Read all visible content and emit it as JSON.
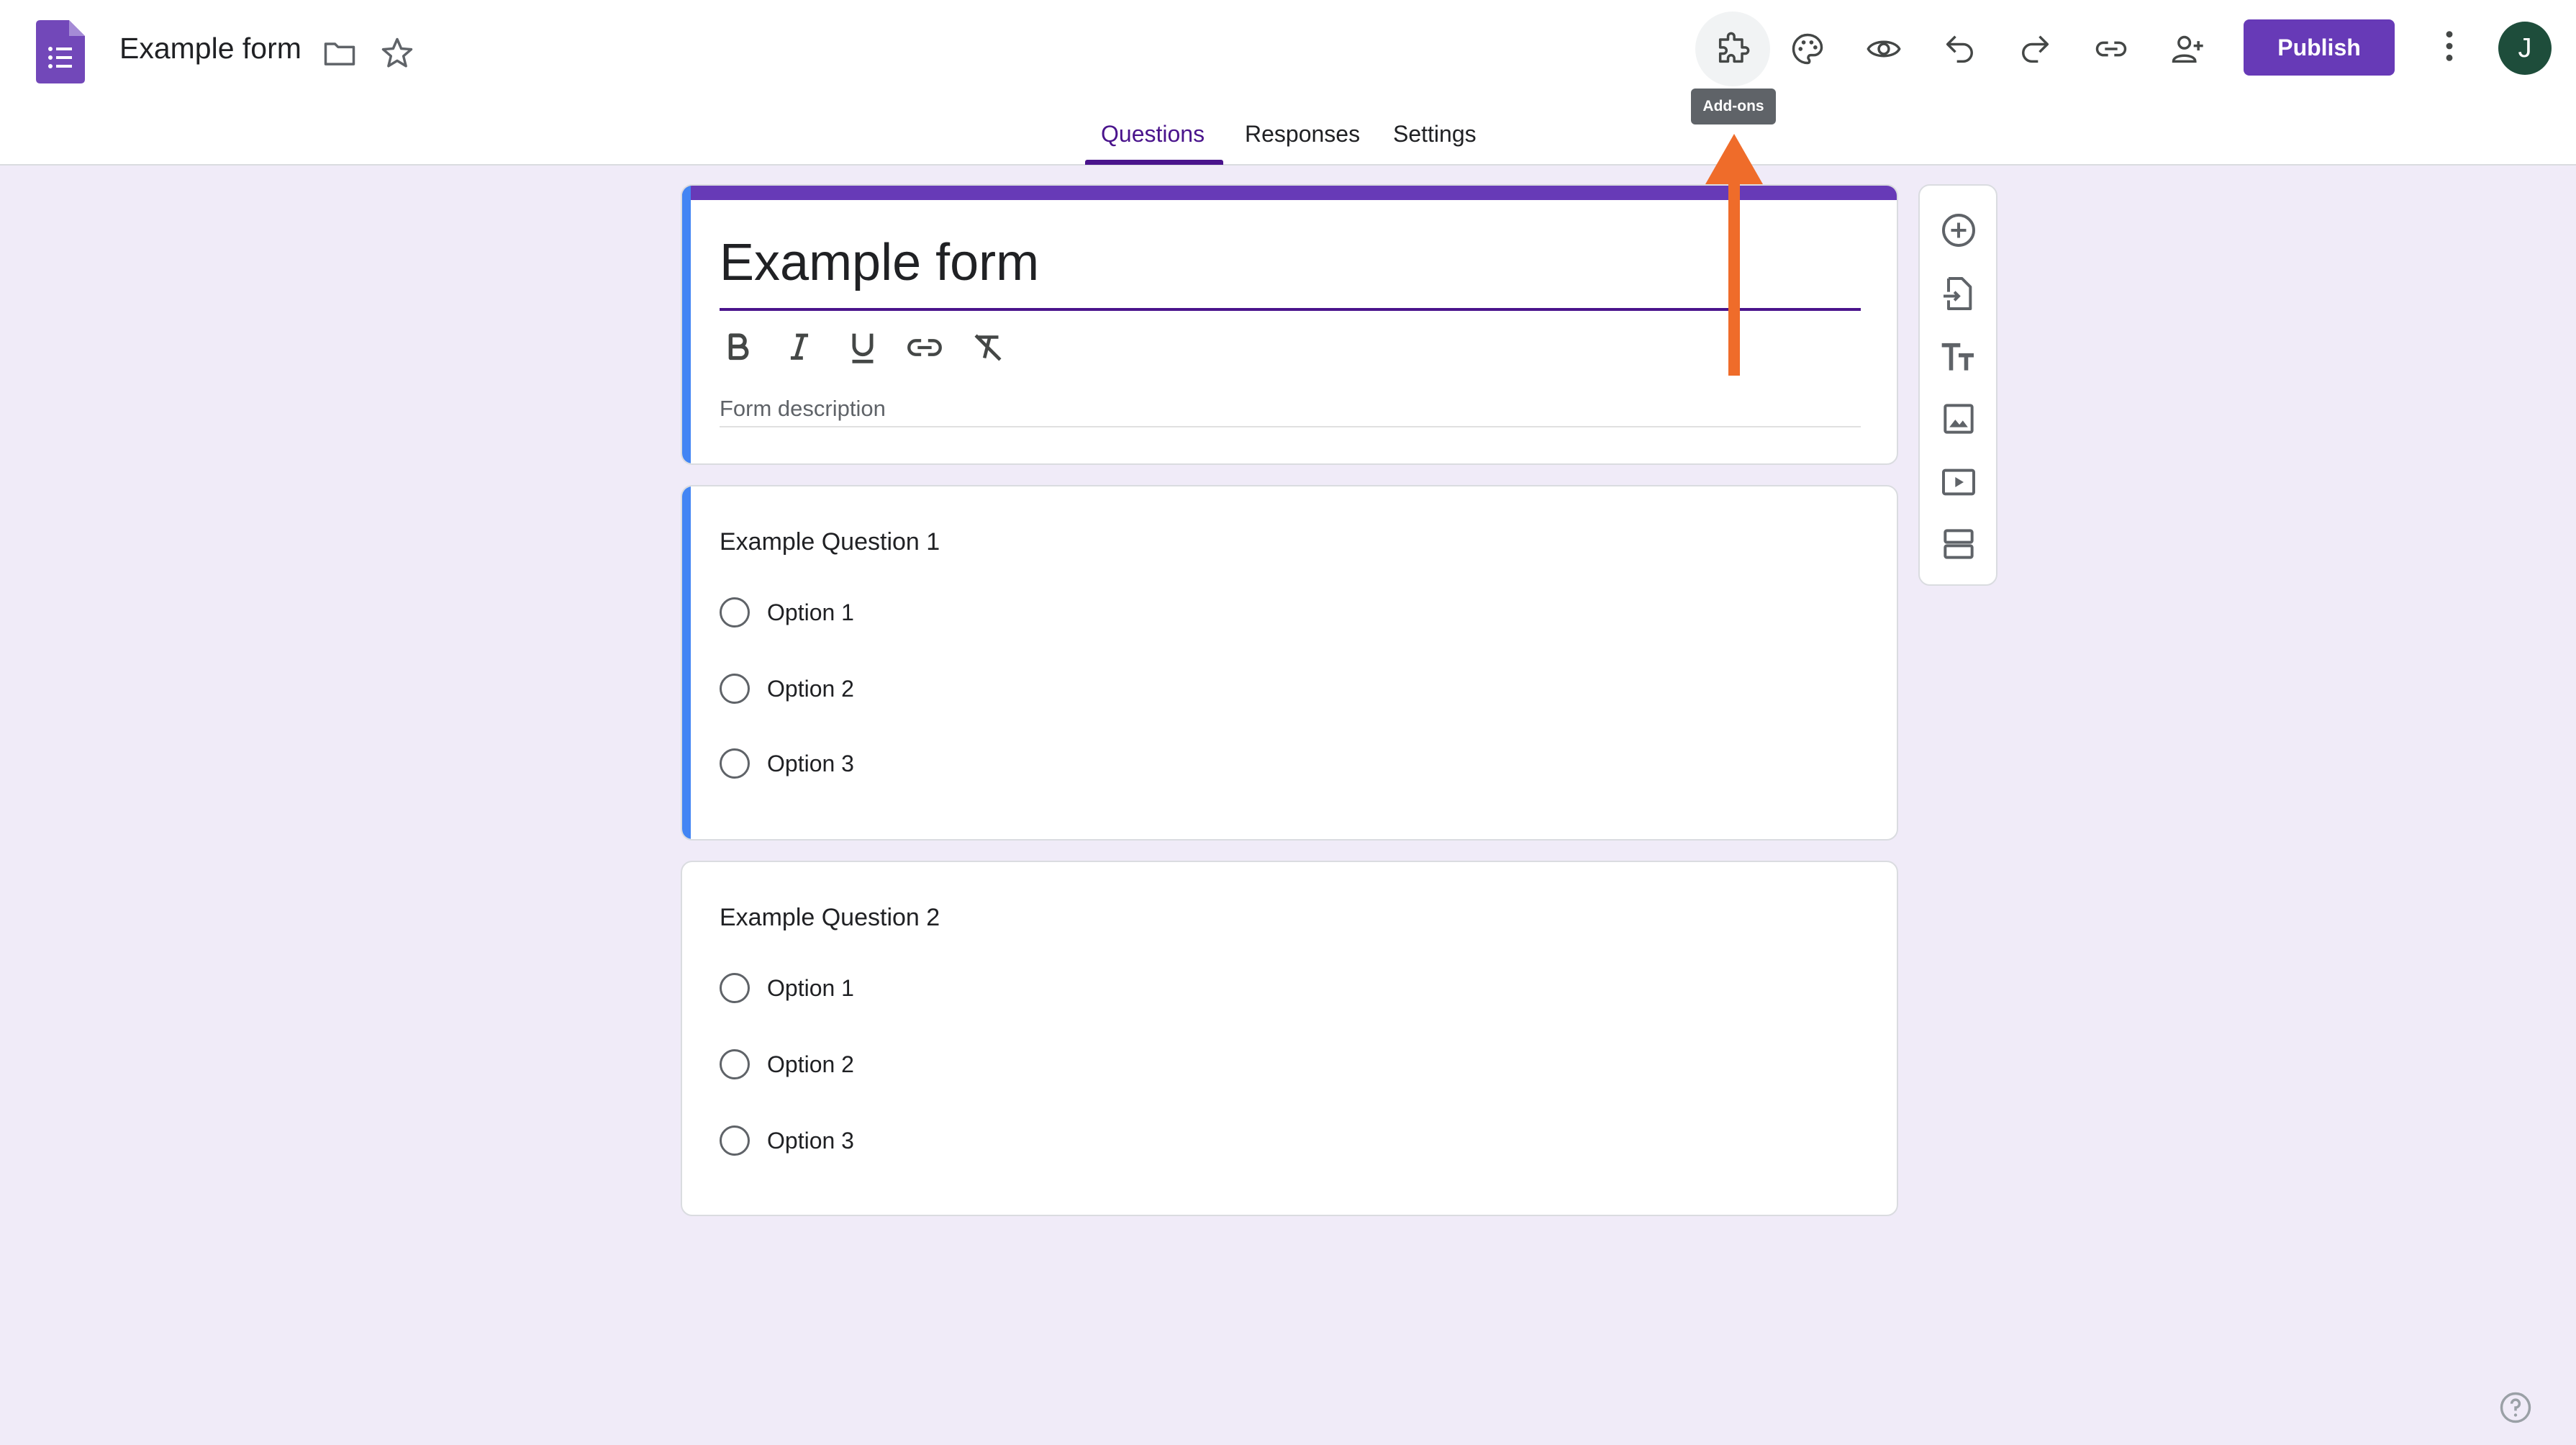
{
  "header": {
    "doc_title": "Example form",
    "publish_label": "Publish",
    "avatar_initial": "J",
    "tooltip": "Add-ons",
    "tools": [
      "puzzle-icon",
      "palette-icon",
      "eye-icon",
      "undo-icon",
      "redo-icon",
      "link-icon",
      "add-person-icon",
      "more-vert-icon"
    ]
  },
  "tabs": [
    {
      "label": "Questions",
      "active": true
    },
    {
      "label": "Responses",
      "active": false
    },
    {
      "label": "Settings",
      "active": false
    }
  ],
  "form": {
    "title": "Example form",
    "description_placeholder": "Form description",
    "format_tools": [
      "bold-icon",
      "italic-icon",
      "underline-icon",
      "link-icon",
      "clear-format-icon"
    ]
  },
  "questions": [
    {
      "title": "Example Question 1",
      "options": [
        "Option 1",
        "Option 2",
        "Option 3"
      ]
    },
    {
      "title": "Example Question 2",
      "options": [
        "Option 1",
        "Option 2",
        "Option 3"
      ]
    }
  ],
  "side_toolbar": [
    "add-circle-icon",
    "import-icon",
    "title-text-icon",
    "image-icon",
    "video-icon",
    "section-icon"
  ],
  "colors": {
    "accent": "#673ab7",
    "background": "#f0ebf8",
    "question_highlight": "#4285f4",
    "annotation_arrow": "#ef6c2a"
  }
}
